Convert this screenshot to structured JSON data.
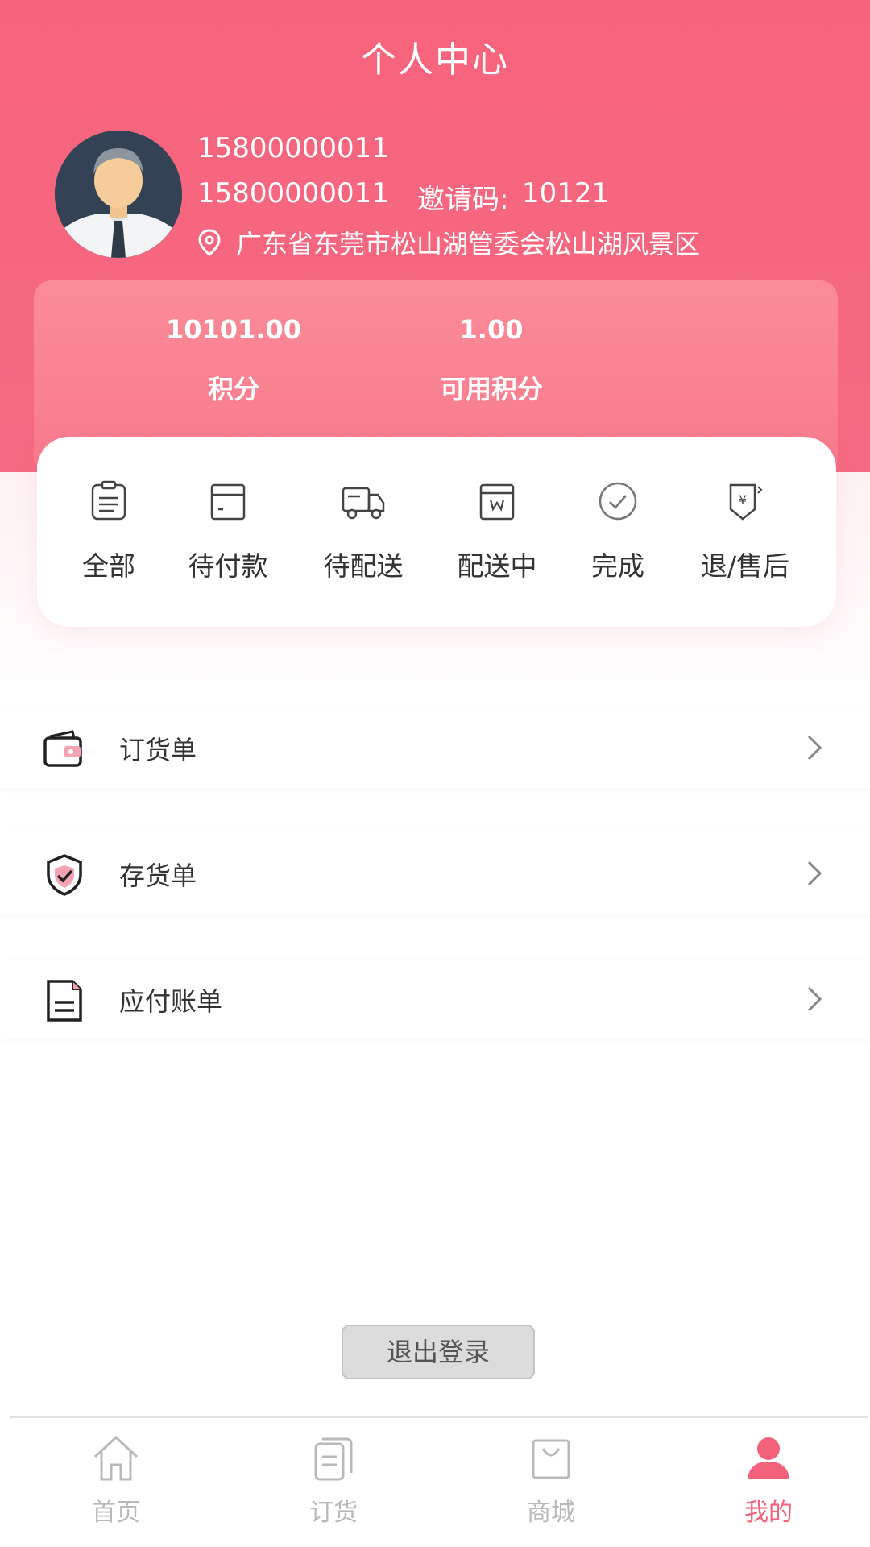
{
  "header": {
    "title": "个人中心"
  },
  "user": {
    "name": "15800000011",
    "phone": "15800000011",
    "invite_label": "邀请码:",
    "invite_code": "10121",
    "address": "广东省东莞市松山湖管委会松山湖风景区"
  },
  "points": {
    "total_value": "10101.00",
    "total_label": "积分",
    "available_value": "1.00",
    "available_label": "可用积分"
  },
  "orders": {
    "items": [
      {
        "label": "全部",
        "icon": "clipboard-icon"
      },
      {
        "label": "待付款",
        "icon": "wallet-card-icon"
      },
      {
        "label": "待配送",
        "icon": "truck-icon"
      },
      {
        "label": "配送中",
        "icon": "package-icon"
      },
      {
        "label": "完成",
        "icon": "check-circle-icon"
      },
      {
        "label": "退/售后",
        "icon": "refund-icon"
      }
    ]
  },
  "menu": {
    "items": [
      {
        "label": "订货单",
        "icon": "wallet-icon"
      },
      {
        "label": "存货单",
        "icon": "shield-check-icon"
      },
      {
        "label": "应付账单",
        "icon": "bill-document-icon"
      }
    ]
  },
  "logout": {
    "label": "退出登录"
  },
  "tabbar": {
    "items": [
      {
        "label": "首页",
        "icon": "home-icon",
        "active": false
      },
      {
        "label": "订货",
        "icon": "documents-icon",
        "active": false
      },
      {
        "label": "商城",
        "icon": "shopping-bag-icon",
        "active": false
      },
      {
        "label": "我的",
        "icon": "user-icon",
        "active": true
      }
    ]
  },
  "colors": {
    "brand": "#f7637c",
    "brand_light": "#fa8b98",
    "active_tab": "#f3627a",
    "inactive_tab": "#b9b9b9"
  }
}
